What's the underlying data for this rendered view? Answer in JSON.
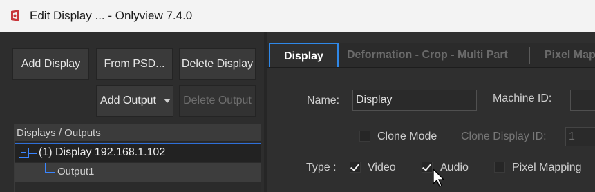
{
  "window": {
    "title": "Edit Display ... - Onlyview  7.4.0",
    "icon": "onlyview-logo-icon"
  },
  "toolbar": {
    "add_display": "Add Display",
    "from_psd": "From PSD...",
    "delete_display": "Delete Display",
    "add_output": "Add Output",
    "delete_output": "Delete Output"
  },
  "tree": {
    "header": "Displays / Outputs",
    "display_item": "(1)  Display  192.168.1.102",
    "output_item": "Output1"
  },
  "tabs": [
    {
      "label": "Display"
    },
    {
      "label": "Deformation - Crop - Multi Part"
    },
    {
      "label": "Pixel Mapping"
    }
  ],
  "form": {
    "name_label": "Name:",
    "name_value": "Display",
    "machine_id_label": "Machine ID:",
    "machine_id_value": "",
    "clone_mode_label": "Clone Mode",
    "clone_mode_checked": false,
    "clone_display_id_label": "Clone Display ID:",
    "clone_display_id_value": "1",
    "type_label": "Type :",
    "video_label": "Video",
    "video_checked": true,
    "audio_label": "Audio",
    "audio_checked": true,
    "pixel_mapping_label": "Pixel Mapping",
    "pixel_mapping_checked": false
  },
  "colors": {
    "accent": "#2f88e8",
    "background": "#2f2f2f",
    "titlebar": "#f3f3f3"
  }
}
